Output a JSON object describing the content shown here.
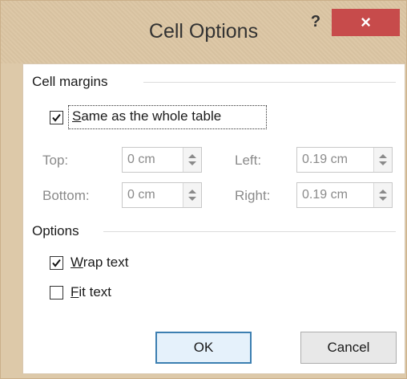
{
  "dialog": {
    "title": "Cell Options",
    "help_label": "?",
    "close_label": "×"
  },
  "cell_margins": {
    "group_label": "Cell margins",
    "same_as_table": {
      "label_accel": "S",
      "label_rest": "ame as the whole table",
      "checked": true
    },
    "top": {
      "label": "Top:",
      "value": "0 cm"
    },
    "bottom": {
      "label": "Bottom:",
      "value": "0 cm"
    },
    "left": {
      "label": "Left:",
      "value": "0.19 cm"
    },
    "right": {
      "label": "Right:",
      "value": "0.19 cm"
    }
  },
  "options": {
    "group_label": "Options",
    "wrap_text": {
      "label_accel": "W",
      "label_rest": "rap text",
      "checked": true
    },
    "fit_text": {
      "label_accel": "F",
      "label_rest": "it text",
      "checked": false
    }
  },
  "buttons": {
    "ok_label": "OK",
    "cancel_label": "Cancel"
  },
  "colors": {
    "close_button": "#c74b4b",
    "titlebar": "#dcc6a4",
    "default_button_border": "#3c7fb1"
  }
}
